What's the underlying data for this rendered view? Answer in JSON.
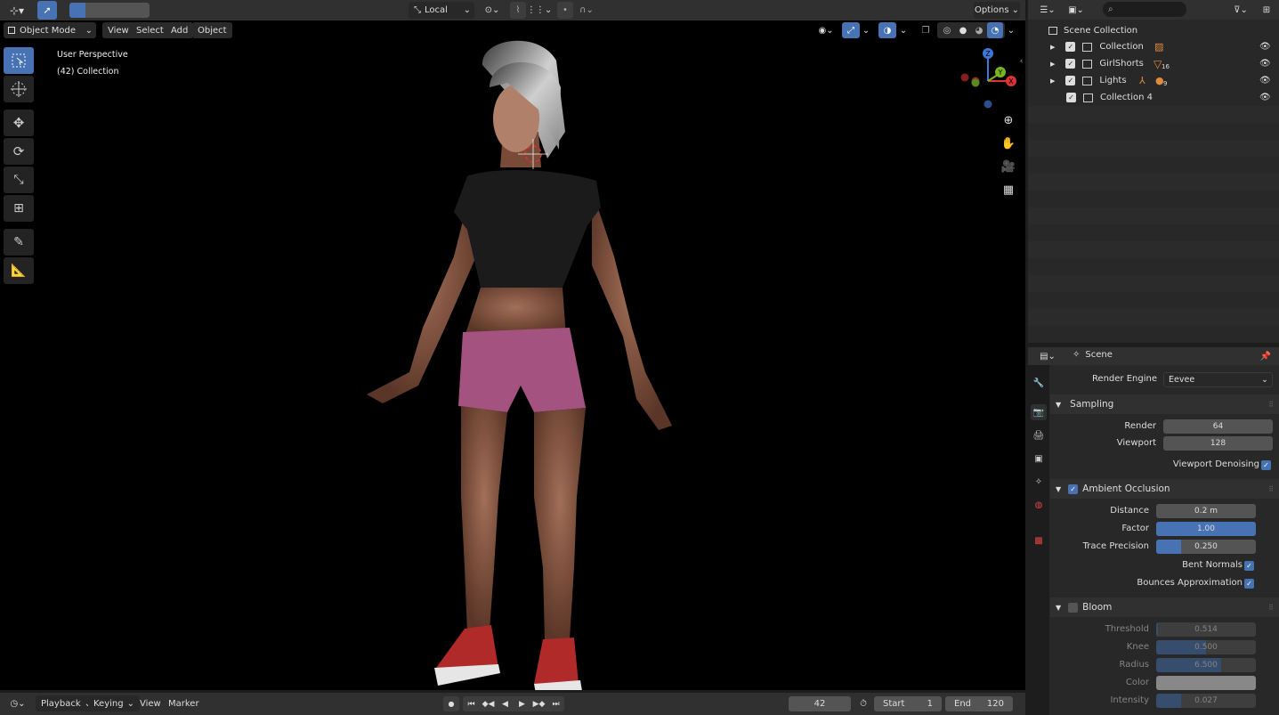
{
  "header": {
    "transform_orientation": "Local",
    "options_label": "Options"
  },
  "viewport": {
    "mode": "Object Mode",
    "menus": [
      "View",
      "Select",
      "Add",
      "Object"
    ],
    "overlay_title": "User Perspective",
    "overlay_subtitle": "(42) Collection",
    "gizmo_axes": [
      "Z",
      "Y",
      "X"
    ]
  },
  "outliner": {
    "root": "Scene Collection",
    "items": [
      {
        "label": "Collection",
        "extra": ""
      },
      {
        "label": "GirlShorts",
        "extra": "16"
      },
      {
        "label": "Lights",
        "extra": "9"
      },
      {
        "label": "Collection 4",
        "extra": ""
      }
    ]
  },
  "properties": {
    "context": "Scene",
    "render_engine_label": "Render Engine",
    "render_engine": "Eevee",
    "sampling": {
      "title": "Sampling",
      "render_label": "Render",
      "render": "64",
      "viewport_label": "Viewport",
      "viewport": "128",
      "denoise_label": "Viewport Denoising"
    },
    "ao": {
      "title": "Ambient Occlusion",
      "distance_label": "Distance",
      "distance": "0.2 m",
      "factor_label": "Factor",
      "factor": "1.00",
      "factor_fill": 1.0,
      "trace_label": "Trace Precision",
      "trace": "0.250",
      "trace_fill": 0.25,
      "bent_label": "Bent Normals",
      "bounces_label": "Bounces Approximation"
    },
    "bloom": {
      "title": "Bloom",
      "threshold_label": "Threshold",
      "threshold": "0.514",
      "threshold_fill": 0.02,
      "knee_label": "Knee",
      "knee": "0.500",
      "knee_fill": 0.5,
      "radius_label": "Radius",
      "radius": "6.500",
      "radius_fill": 0.65,
      "color_label": "Color",
      "intensity_label": "Intensity",
      "intensity": "0.027",
      "intensity_fill": 0.25
    }
  },
  "timeline": {
    "menus": [
      "Playback",
      "Keying",
      "View",
      "Marker"
    ],
    "current_frame": "42",
    "start_label": "Start",
    "start": "1",
    "end_label": "End",
    "end": "120"
  },
  "colors": {
    "accent": "#4772b3",
    "panel": "#282828",
    "header": "#303030",
    "shorts": "#a4527f",
    "shirt": "#1c1b1c",
    "skin": "#8a5a45"
  }
}
